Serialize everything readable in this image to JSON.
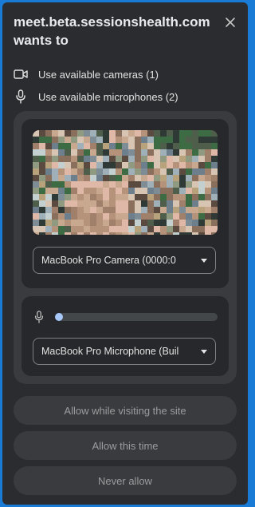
{
  "dialog": {
    "title": "meet.beta.sessionshealth.com wants to"
  },
  "permissions": [
    {
      "icon": "video-camera-icon",
      "label": "Use available cameras (1)"
    },
    {
      "icon": "microphone-icon",
      "label": "Use available microphones (2)"
    }
  ],
  "camera": {
    "selected": "MacBook Pro Camera (0000:0"
  },
  "microphone": {
    "selected": "MacBook Pro Microphone (Buil",
    "level": 0.0
  },
  "buttons": {
    "allow_visit": "Allow while visiting the site",
    "allow_once": "Allow this time",
    "never": "Never allow"
  },
  "colors": {
    "background": "#1a7bd6",
    "dialog": "#2b2c2f",
    "accent": "#a8c7fa"
  }
}
